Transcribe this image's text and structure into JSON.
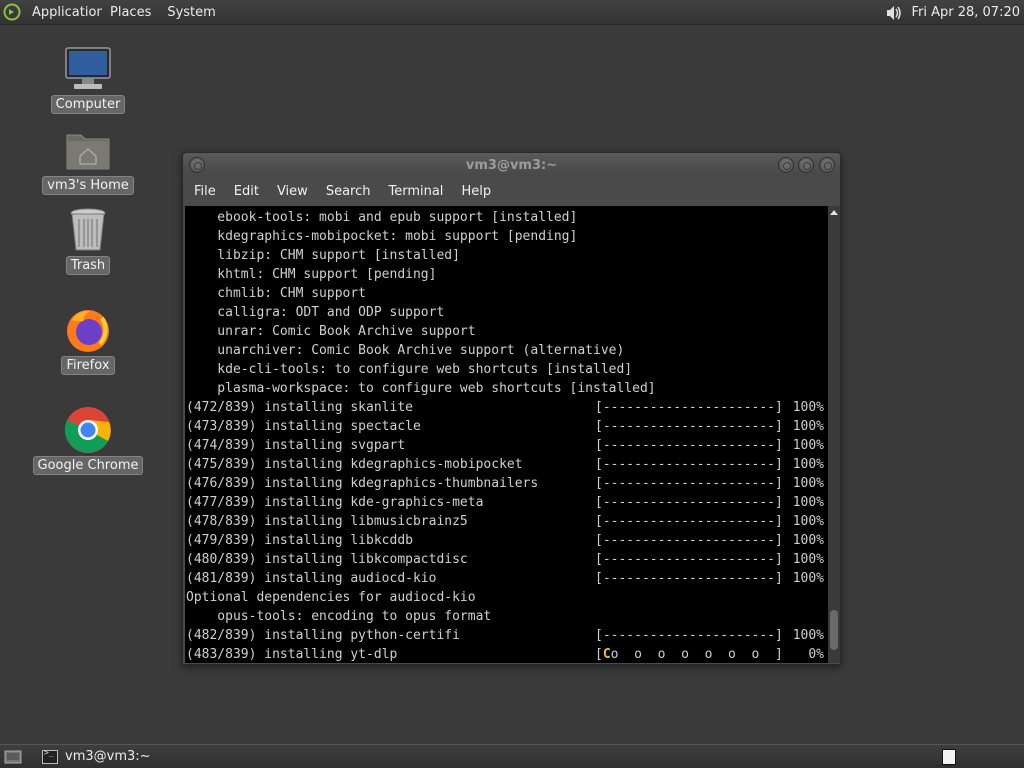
{
  "top_panel": {
    "applications": "Applications",
    "places": "Places",
    "system": "System",
    "clock": "Fri Apr 28, 07:20"
  },
  "desktop_icons": [
    {
      "label": "Computer",
      "icon": "computer-icon"
    },
    {
      "label": "vm3's Home",
      "icon": "home-folder-icon"
    },
    {
      "label": "Trash",
      "icon": "trash-icon"
    },
    {
      "label": "Firefox",
      "icon": "firefox-icon"
    },
    {
      "label": "Google Chrome",
      "icon": "chrome-icon"
    }
  ],
  "window": {
    "title": "vm3@vm3:~",
    "menu": [
      "File",
      "Edit",
      "View",
      "Search",
      "Terminal",
      "Help"
    ]
  },
  "terminal": {
    "lines": [
      {
        "text": "    ebook-tools: mobi and epub support [installed]"
      },
      {
        "text": "    kdegraphics-mobipocket: mobi support [pending]"
      },
      {
        "text": "    libzip: CHM support [installed]"
      },
      {
        "text": "    khtml: CHM support [pending]"
      },
      {
        "text": "    chmlib: CHM support"
      },
      {
        "text": "    calligra: ODT and ODP support"
      },
      {
        "text": "    unrar: Comic Book Archive support"
      },
      {
        "text": "    unarchiver: Comic Book Archive support (alternative)"
      },
      {
        "text": "    kde-cli-tools: to configure web shortcuts [installed]"
      },
      {
        "text": "    plasma-workspace: to configure web shortcuts [installed]"
      },
      {
        "text": "(472/839) installing skanlite",
        "bar": "[----------------------]",
        "pct": "100%"
      },
      {
        "text": "(473/839) installing spectacle",
        "bar": "[----------------------]",
        "pct": "100%"
      },
      {
        "text": "(474/839) installing svgpart",
        "bar": "[----------------------]",
        "pct": "100%"
      },
      {
        "text": "(475/839) installing kdegraphics-mobipocket",
        "bar": "[----------------------]",
        "pct": "100%"
      },
      {
        "text": "(476/839) installing kdegraphics-thumbnailers",
        "bar": "[----------------------]",
        "pct": "100%"
      },
      {
        "text": "(477/839) installing kde-graphics-meta",
        "bar": "[----------------------]",
        "pct": "100%"
      },
      {
        "text": "(478/839) installing libmusicbrainz5",
        "bar": "[----------------------]",
        "pct": "100%"
      },
      {
        "text": "(479/839) installing libkcddb",
        "bar": "[----------------------]",
        "pct": "100%"
      },
      {
        "text": "(480/839) installing libkcompactdisc",
        "bar": "[----------------------]",
        "pct": "100%"
      },
      {
        "text": "(481/839) installing audiocd-kio",
        "bar": "[----------------------]",
        "pct": "100%"
      },
      {
        "text": "Optional dependencies for audiocd-kio"
      },
      {
        "text": "    opus-tools: encoding to opus format"
      },
      {
        "text": "(482/839) installing python-certifi",
        "bar": "[----------------------]",
        "pct": "100%"
      },
      {
        "text": "(483/839) installing yt-dlp",
        "bar_cursor": "[",
        "bar_c": "C",
        "bar_rest": "o  o  o  o  o  o  o  ]",
        "pct": "0%"
      }
    ]
  },
  "taskbar": {
    "window_label": "vm3@vm3:~"
  }
}
